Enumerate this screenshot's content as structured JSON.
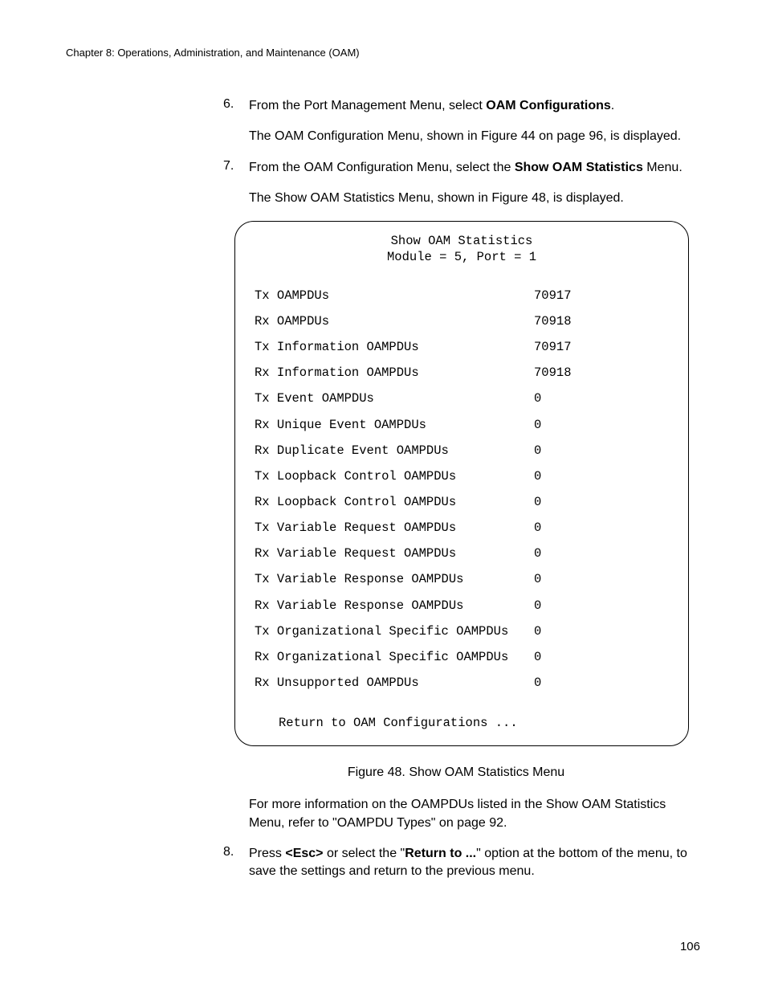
{
  "header": "Chapter 8: Operations, Administration, and Maintenance (OAM)",
  "items": {
    "n6": "6.",
    "t6a": "From the Port Management Menu, select ",
    "t6b": "OAM Configurations",
    "t6c": ".",
    "p6d": "The OAM Configuration Menu, shown in Figure 44 on page 96, is displayed.",
    "n7": "7.",
    "t7a": "From the OAM Configuration Menu, select the ",
    "t7b": "Show OAM Statistics",
    "t7c": " Menu.",
    "p7d": "The Show OAM Statistics Menu, shown in Figure 48, is displayed.",
    "n8": "8.",
    "t8a": "Press ",
    "t8b": "<Esc>",
    "t8c": " or select the \"",
    "t8d": "Return to ...",
    "t8e": "\" option at the bottom of the menu, to save the settings and return to the previous menu."
  },
  "figure": {
    "title": "Show OAM Statistics",
    "subtitle": "Module = 5, Port = 1",
    "return": "Return to OAM Configurations ...",
    "caption": "Figure 48. Show OAM Statistics Menu"
  },
  "chart_data": {
    "type": "table",
    "rows": [
      {
        "label": "Tx OAMPDUs",
        "value": "70917"
      },
      {
        "label": "Rx OAMPDUs",
        "value": "70918"
      },
      {
        "label": "Tx Information OAMPDUs",
        "value": "70917"
      },
      {
        "label": "Rx Information OAMPDUs",
        "value": "70918"
      },
      {
        "label": "Tx Event OAMPDUs",
        "value": "0"
      },
      {
        "label": "Rx Unique Event OAMPDUs",
        "value": "0"
      },
      {
        "label": "Rx Duplicate Event OAMPDUs",
        "value": "0"
      },
      {
        "label": "Tx Loopback Control OAMPDUs",
        "value": "0"
      },
      {
        "label": "Rx Loopback Control OAMPDUs",
        "value": "0"
      },
      {
        "label": "Tx Variable Request OAMPDUs",
        "value": "0"
      },
      {
        "label": "Rx Variable Request OAMPDUs",
        "value": "0"
      },
      {
        "label": "Tx Variable Response OAMPDUs",
        "value": "0"
      },
      {
        "label": "Rx Variable Response OAMPDUs",
        "value": "0"
      },
      {
        "label": "Tx Organizational Specific OAMPDUs",
        "value": "0"
      },
      {
        "label": "Rx Organizational Specific OAMPDUs",
        "value": "0"
      },
      {
        "label": "Rx Unsupported OAMPDUs",
        "value": "0"
      }
    ]
  },
  "post": {
    "p1": "For more information on the OAMPDUs listed in the Show OAM Statistics Menu, refer to \"OAMPDU Types\" on page 92."
  },
  "page": "106"
}
